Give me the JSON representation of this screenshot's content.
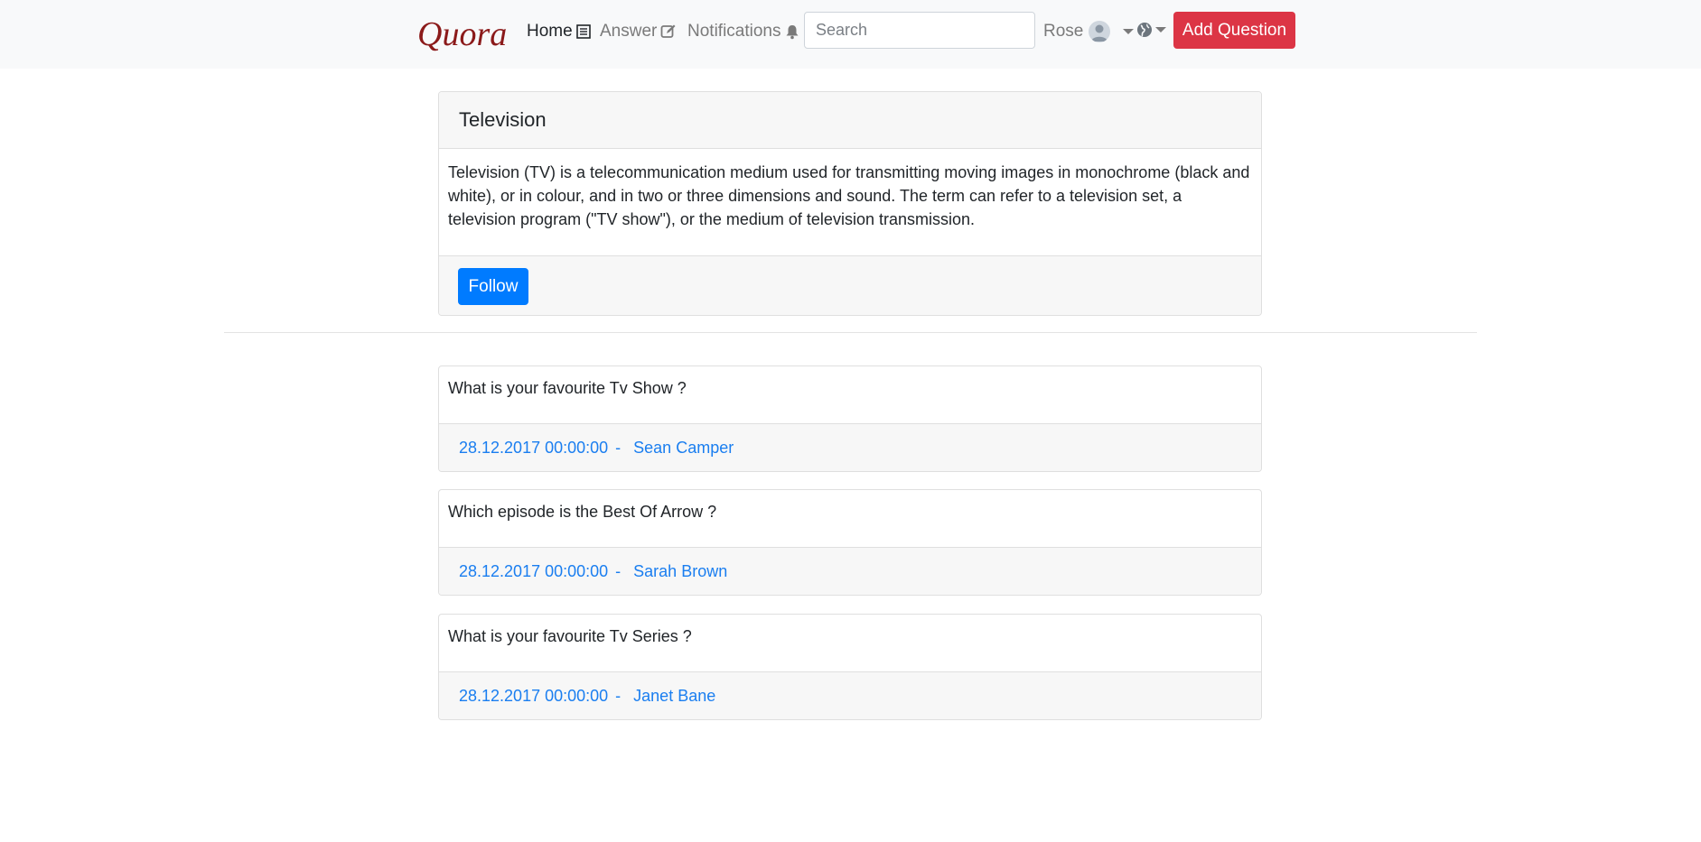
{
  "navbar": {
    "brand": "Quora",
    "home_label": "Home",
    "answer_label": "Answer",
    "notifications_label": "Notifications",
    "search_placeholder": "Search",
    "user_name": "Rose",
    "add_question_label": "Add Question"
  },
  "topic": {
    "title": "Television",
    "description": "Television (TV) is a telecommunication medium used for transmitting moving images in monochrome (black and white), or in colour, and in two or three dimensions and sound. The term can refer to a television set, a television program (\"TV show\"), or the medium of television transmission.",
    "follow_label": "Follow"
  },
  "questions": [
    {
      "title": "What is your favourite Tv Show ?",
      "date": "28.12.2017 00:00:00",
      "separator": "-",
      "author": "Sean Camper"
    },
    {
      "title": "Which episode is the Best Of Arrow ?",
      "date": "28.12.2017 00:00:00",
      "separator": "-",
      "author": "Sarah Brown"
    },
    {
      "title": "What is your favourite Tv Series ?",
      "date": "28.12.2017 00:00:00",
      "separator": "-",
      "author": "Janet Bane"
    }
  ],
  "colors": {
    "brand": "#8b1a1a",
    "primary": "#007bff",
    "danger": "#dc3545",
    "link": "#1a7ef0"
  },
  "icons": [
    "list-icon",
    "edit-icon",
    "bell-icon",
    "user-avatar-icon",
    "globe-icon",
    "caret-down-icon"
  ]
}
